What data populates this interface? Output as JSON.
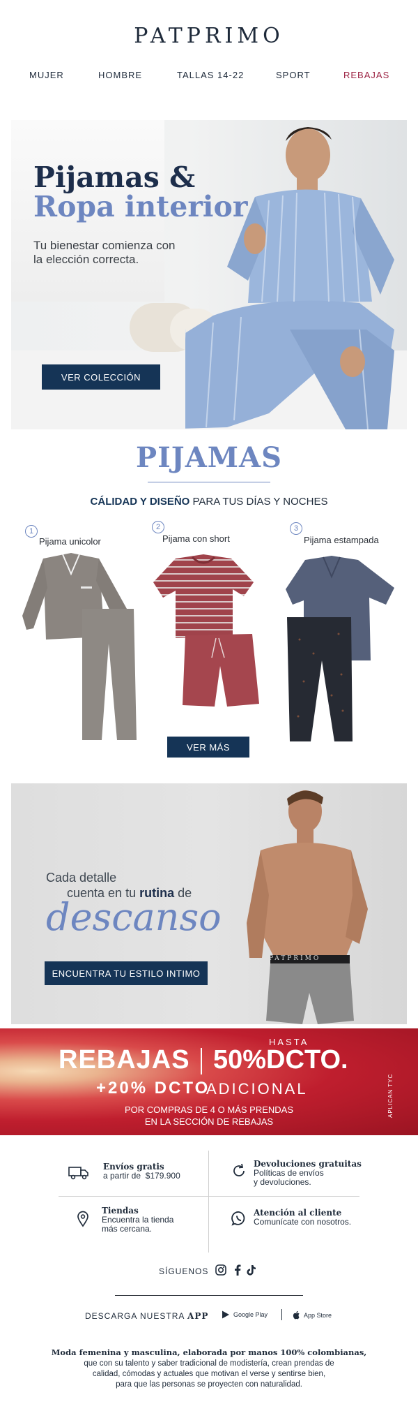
{
  "header": {
    "logo": "PATPRIMO"
  },
  "nav": {
    "items": [
      "MUJER",
      "HOMBRE",
      "TALLAS 14-22",
      "SPORT",
      "REBAJAS"
    ]
  },
  "hero": {
    "title_line1": "Pijamas &",
    "title_line2": "Ropa interior",
    "subtitle_line1": "Tu bienestar comienza con",
    "subtitle_line2": "la elección correcta.",
    "button": "VER COLECCIÓN"
  },
  "pijamas": {
    "title": "PIJAMAS",
    "subtitle_bold": "CÁLIDAD Y DISEÑO",
    "subtitle_rest": " PARA TUS DÍAS Y NOCHES",
    "products": [
      {
        "num": "1",
        "label": "Pijama unicolor"
      },
      {
        "num": "2",
        "label": "Pijama con short"
      },
      {
        "num": "3",
        "label": "Pijama estampada"
      }
    ],
    "button": "VER MÁS",
    "colors": {
      "grey": "#8b8580",
      "red": "#a0434b",
      "navy": "#55607a",
      "dark": "#262a33"
    }
  },
  "descanso": {
    "line1": "Cada detalle",
    "line2_pre": "cuenta en tu ",
    "line2_bold": "rutina",
    "line2_post": " de",
    "big": "descanso",
    "button": "ENCUENTRA TU ESTILO INTIMO",
    "waistband": "PATPRIMO"
  },
  "rebajas": {
    "word": "REBAJAS",
    "hasta": "HASTA",
    "pct": "50%DCTO.",
    "plus": "+20% DCTO",
    "adicional": "ADICIONAL",
    "note_line1": "POR COMPRAS DE 4 O MÁS PRENDAS",
    "note_line2": "EN LA SECCIÓN DE REBAJAS",
    "tyc": "APLICAN TYC"
  },
  "benefits": [
    {
      "icon": "truck-icon",
      "title": "Envíos gratis",
      "text1": "a partir de  $179.900",
      "text2": ""
    },
    {
      "icon": "return-icon",
      "title": "Devoluciones gratuitas",
      "text1": "Políticas de envíos",
      "text2": "y devoluciones."
    },
    {
      "icon": "location-pin-icon",
      "title": "Tiendas",
      "text1": "Encuentra la tienda",
      "text2": "más cercana."
    },
    {
      "icon": "whatsapp-icon",
      "title": "Atención al cliente",
      "text1": "Comunícate con nosotros.",
      "text2": ""
    }
  ],
  "footer": {
    "siguenos": "SÍGUENOS",
    "social": [
      "instagram-icon",
      "facebook-icon",
      "tiktok-icon"
    ],
    "descarga_pre": "DESCARGA NUESTRA ",
    "descarga_bold": "APP",
    "google_play": "Google Play",
    "app_store": "App Store",
    "text_bold": "Moda femenina y masculina, elaborada por manos 100% colombianas,",
    "text_line2": "que con su talento y saber tradicional de modistería, crean prendas de",
    "text_line3": "calidad, cómodas y actuales que motivan el verse y sentirse bien,",
    "text_line4": "para que las personas se proyecten con naturalidad."
  }
}
